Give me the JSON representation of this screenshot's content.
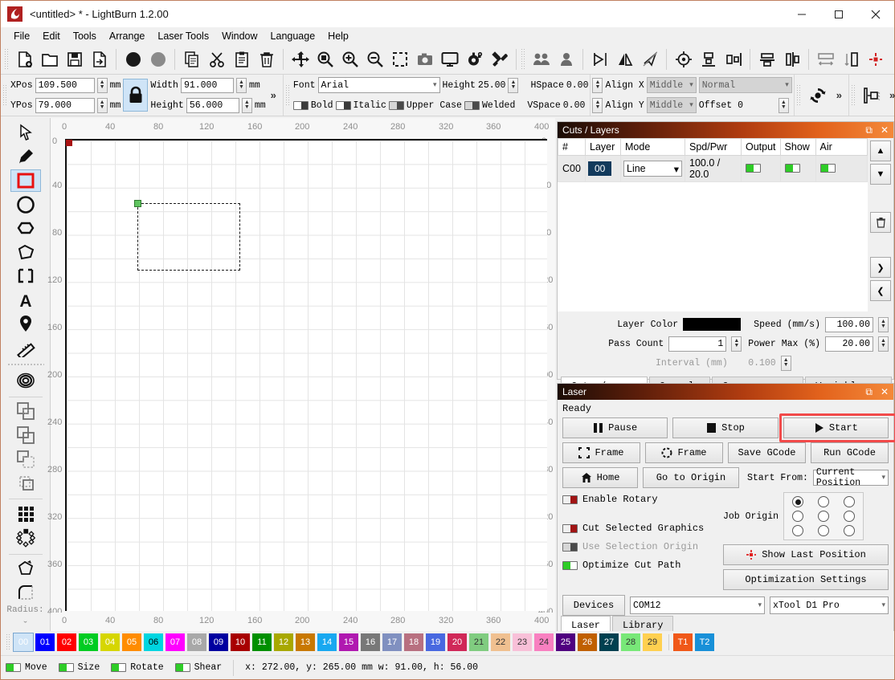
{
  "window": {
    "title": "<untitled> * - LightBurn 1.2.00",
    "minimize": "–",
    "maximize": "☐",
    "close": "✕"
  },
  "menu": [
    {
      "label": "File"
    },
    {
      "label": "Edit"
    },
    {
      "label": "Tools"
    },
    {
      "label": "Arrange"
    },
    {
      "label": "Laser Tools"
    },
    {
      "label": "Window"
    },
    {
      "label": "Language"
    },
    {
      "label": "Help"
    }
  ],
  "toolbar": {
    "icons": [
      "new-file-icon",
      "open-folder-icon",
      "save-icon",
      "export-icon",
      "undo-icon",
      "redo-icon",
      "copy-icon",
      "cut-icon",
      "paste-icon",
      "delete-icon",
      "move-icon",
      "zoom-fit-icon",
      "zoom-in-icon",
      "zoom-out-icon",
      "zoom-selection-icon",
      "camera-icon",
      "monitor-icon",
      "settings-gear-icon",
      "device-settings-icon",
      "group-icon",
      "ungroup-icon",
      "flip-horizontal-icon",
      "flip-vertical-icon",
      "close-path-icon",
      "align-center-icon",
      "align-bottom-icon",
      "align-top-icon",
      "distribute-horizontal-icon",
      "distribute-vertical-icon",
      "spread-horizontal-icon",
      "spread-vertical-icon",
      "set-position-icon"
    ]
  },
  "properties": {
    "xpos_label": "XPos",
    "xpos_value": "109.500",
    "xpos_unit": "mm",
    "ypos_label": "YPos",
    "ypos_value": "79.000",
    "ypos_unit": "mm",
    "width_label": "Width",
    "width_value": "91.000",
    "width_unit": "mm",
    "height_label": "Height",
    "height_value": "56.000",
    "height_unit": "mm",
    "lock_icon": "lock-icon",
    "expand": "»"
  },
  "text_props": {
    "font_label": "Font",
    "font_value": "Arial",
    "height_label": "Height",
    "height_value": "25.00",
    "hspace_label": "HSpace",
    "hspace_value": "0.00",
    "vspace_label": "VSpace",
    "vspace_value": "0.00",
    "bold_label": "Bold",
    "italic_label": "Italic",
    "uppercase_label": "Upper Case",
    "welded_label": "Welded",
    "align_x_label": "Align X",
    "align_x_value": "Middle",
    "align_y_label": "Align Y",
    "align_y_value": "Middle",
    "normal_value": "Normal",
    "offset_label": "Offset 0",
    "expand": "»",
    "rotate_icon": "rotate-object-icon",
    "offset_icon": "offset-shape-icon"
  },
  "left_tools": [
    {
      "name": "select-tool",
      "icon": "cursor-arrow-icon",
      "selected": false
    },
    {
      "name": "draw-line-tool",
      "icon": "pencil-icon",
      "selected": false
    },
    {
      "name": "rectangle-tool",
      "icon": "rectangle-icon",
      "selected": true
    },
    {
      "name": "ellipse-tool",
      "icon": "circle-icon",
      "selected": false
    },
    {
      "name": "polygon-tool",
      "icon": "hexagon-icon",
      "selected": false
    },
    {
      "name": "freehand-tool",
      "icon": "polygon-shape-icon",
      "selected": false
    },
    {
      "name": "edit-nodes-tool",
      "icon": "node-edit-icon",
      "selected": false
    },
    {
      "name": "text-tool",
      "icon": "text-a-icon",
      "selected": false
    },
    {
      "name": "position-tool",
      "icon": "map-pin-icon",
      "selected": false
    },
    {
      "name": "measure-tool",
      "icon": "ruler-icon",
      "selected": false
    },
    {
      "name": "offset-shapes-tool",
      "icon": "offset-rings-icon",
      "selected": false
    },
    {
      "name": "boolean-union-tool",
      "icon": "boolean-weld-icon",
      "selected": false
    },
    {
      "name": "boolean-subtract-tool",
      "icon": "boolean-subtract-icon",
      "selected": false
    },
    {
      "name": "boolean-intersect-tool",
      "icon": "boolean-intersect-icon",
      "selected": false
    },
    {
      "name": "boolean-cut-tool",
      "icon": "boolean-cut-icon",
      "selected": false
    },
    {
      "name": "grid-array-tool",
      "icon": "grid-array-icon",
      "selected": false
    },
    {
      "name": "circular-array-tool",
      "icon": "circular-array-icon",
      "selected": false
    },
    {
      "name": "trace-tool",
      "icon": "close-path-arrow-icon",
      "selected": false
    },
    {
      "name": "fillet-radius-tool",
      "icon": "rounded-corner-icon",
      "selected": false
    }
  ],
  "left_tools_radius_label": "Radius:",
  "left_tools_more": "ˇ",
  "canvas": {
    "h_ticks": [
      "0",
      "40",
      "80",
      "120",
      "160",
      "200",
      "240",
      "280",
      "320",
      "360",
      "400"
    ],
    "v_ticks": [
      "0",
      "40",
      "80",
      "120",
      "160",
      "200",
      "240",
      "280",
      "320",
      "360",
      "400"
    ],
    "origin_marker": "origin-red-square",
    "selection_handle": "selection-handle-green"
  },
  "cuts_panel": {
    "title": "Cuts / Layers",
    "float_icon": "restore-icon",
    "close_icon": "close-icon",
    "columns": [
      "#",
      "Layer",
      "Mode",
      "Spd/Pwr",
      "Output",
      "Show",
      "Air"
    ],
    "rows": [
      {
        "num": "C00",
        "layer": "00",
        "mode": "Line",
        "spdpwr": "100.0 / 20.0",
        "output": true,
        "show": true,
        "air": true
      }
    ],
    "side_buttons": [
      "move-up-icon",
      "move-down-icon",
      "delete-icon",
      "move-right-icon",
      "move-left-icon"
    ],
    "layer_color_label": "Layer Color",
    "layer_color_value": "#000000",
    "pass_count_label": "Pass Count",
    "pass_count_value": "1",
    "interval_label": "Interval (mm)",
    "interval_value": "0.100",
    "speed_label": "Speed (mm/s)",
    "speed_value": "100.00",
    "power_label": "Power Max (%)",
    "power_value": "20.00",
    "tabs": [
      {
        "label": "Cuts / Layers",
        "active": true
      },
      {
        "label": "Console",
        "active": false
      },
      {
        "label": "Camera Control",
        "active": false
      },
      {
        "label": "Variable Text",
        "active": false
      }
    ]
  },
  "laser_panel": {
    "title": "Laser",
    "float_icon": "restore-icon",
    "close_icon": "close-icon",
    "status": "Ready",
    "pause_label": "Pause",
    "stop_label": "Stop",
    "start_label": "Start",
    "frame_square_label": "Frame",
    "frame_round_label": "Frame",
    "save_gcode_label": "Save GCode",
    "run_gcode_label": "Run GCode",
    "home_label": "Home",
    "go_to_origin_label": "Go to Origin",
    "start_from_label": "Start From:",
    "start_from_value": "Current Position",
    "job_origin_label": "Job Origin",
    "job_origin_selected_index": 0,
    "enable_rotary_label": "Enable Rotary",
    "cut_selected_label": "Cut Selected Graphics",
    "use_selection_origin_label": "Use Selection Origin",
    "optimize_cut_path_label": "Optimize Cut Path",
    "show_last_position_label": "Show Last Position",
    "optimization_settings_label": "Optimization Settings",
    "devices_label": "Devices",
    "port_value": "COM12",
    "device_value": "xTool D1 Pro",
    "tabs": [
      {
        "label": "Laser",
        "active": true
      },
      {
        "label": "Library",
        "active": false
      }
    ],
    "highlight_color": "#f24a4a"
  },
  "palette": [
    {
      "num": "00",
      "color": "#000000",
      "fg": "#ffffff",
      "selected": true
    },
    {
      "num": "01",
      "color": "#0000ff",
      "fg": "#ffffff"
    },
    {
      "num": "02",
      "color": "#ff0000",
      "fg": "#ffffff"
    },
    {
      "num": "03",
      "color": "#00cc22",
      "fg": "#ffffff"
    },
    {
      "num": "04",
      "color": "#d6d600",
      "fg": "#ffffff"
    },
    {
      "num": "05",
      "color": "#ff8c00",
      "fg": "#ffffff"
    },
    {
      "num": "06",
      "color": "#00d5e0",
      "fg": "#ffffff"
    },
    {
      "num": "07",
      "color": "#ff00ff",
      "fg": "#ffffff"
    },
    {
      "num": "08",
      "color": "#a8a8a8",
      "fg": "#ffffff"
    },
    {
      "num": "09",
      "color": "#0000a0",
      "fg": "#ffffff"
    },
    {
      "num": "10",
      "color": "#a80000",
      "fg": "#ffffff"
    },
    {
      "num": "11",
      "color": "#009000",
      "fg": "#ffffff"
    },
    {
      "num": "12",
      "color": "#a8a800",
      "fg": "#ffffff"
    },
    {
      "num": "13",
      "color": "#c87800",
      "fg": "#ffffff"
    },
    {
      "num": "14",
      "color": "#18a8f0",
      "fg": "#ffffff"
    },
    {
      "num": "15",
      "color": "#b018b0",
      "fg": "#ffffff"
    },
    {
      "num": "16",
      "color": "#787878",
      "fg": "#ffffff"
    },
    {
      "num": "17",
      "color": "#8090c0",
      "fg": "#ffffff"
    },
    {
      "num": "18",
      "color": "#b87080",
      "fg": "#ffffff"
    },
    {
      "num": "19",
      "color": "#4868e0",
      "fg": "#ffffff"
    },
    {
      "num": "20",
      "color": "#d02858",
      "fg": "#ffffff"
    },
    {
      "num": "21",
      "color": "#80cc80",
      "fg": "#333333"
    },
    {
      "num": "22",
      "color": "#f0c090",
      "fg": "#333333"
    },
    {
      "num": "23",
      "color": "#f8c0d8",
      "fg": "#333333"
    },
    {
      "num": "24",
      "color": "#f880c0",
      "fg": "#333333"
    },
    {
      "num": "25",
      "color": "#500080",
      "fg": "#ffffff"
    },
    {
      "num": "26",
      "color": "#c06000",
      "fg": "#ffffff"
    },
    {
      "num": "27",
      "color": "#004050",
      "fg": "#ffffff"
    },
    {
      "num": "28",
      "color": "#78e878",
      "fg": "#333333"
    },
    {
      "num": "29",
      "color": "#ffd050",
      "fg": "#333333"
    },
    {
      "num": "T1",
      "color": "#f05818",
      "fg": "#ffffff"
    },
    {
      "num": "T2",
      "color": "#1890d8",
      "fg": "#ffffff"
    }
  ],
  "status_bar": {
    "move_label": "Move",
    "size_label": "Size",
    "rotate_label": "Rotate",
    "shear_label": "Shear",
    "coords": "x: 272.00,  y: 265.00 mm   w: 91.00,   h: 56.00"
  }
}
